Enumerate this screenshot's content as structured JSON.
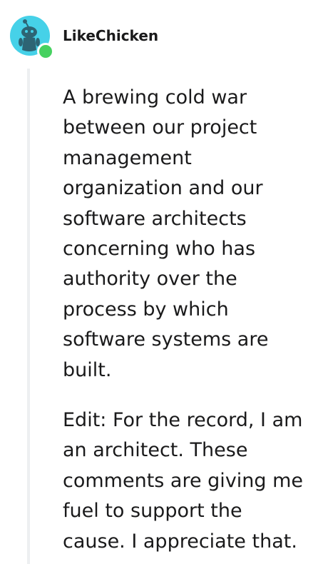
{
  "comment": {
    "username": "LikeChicken",
    "avatar_icon": "snoo-avatar-icon",
    "online_status_icon": "online-dot-icon",
    "avatar_bg_color": "#46d1e8",
    "online_color": "#46d160",
    "paragraphs": [
      "A brewing cold war between our project management organization and our software architects concerning who has authority over the process by which software systems are built.",
      "Edit: For the record, I am an architect. These comments are giving me fuel to support the cause. I appreciate that."
    ]
  }
}
